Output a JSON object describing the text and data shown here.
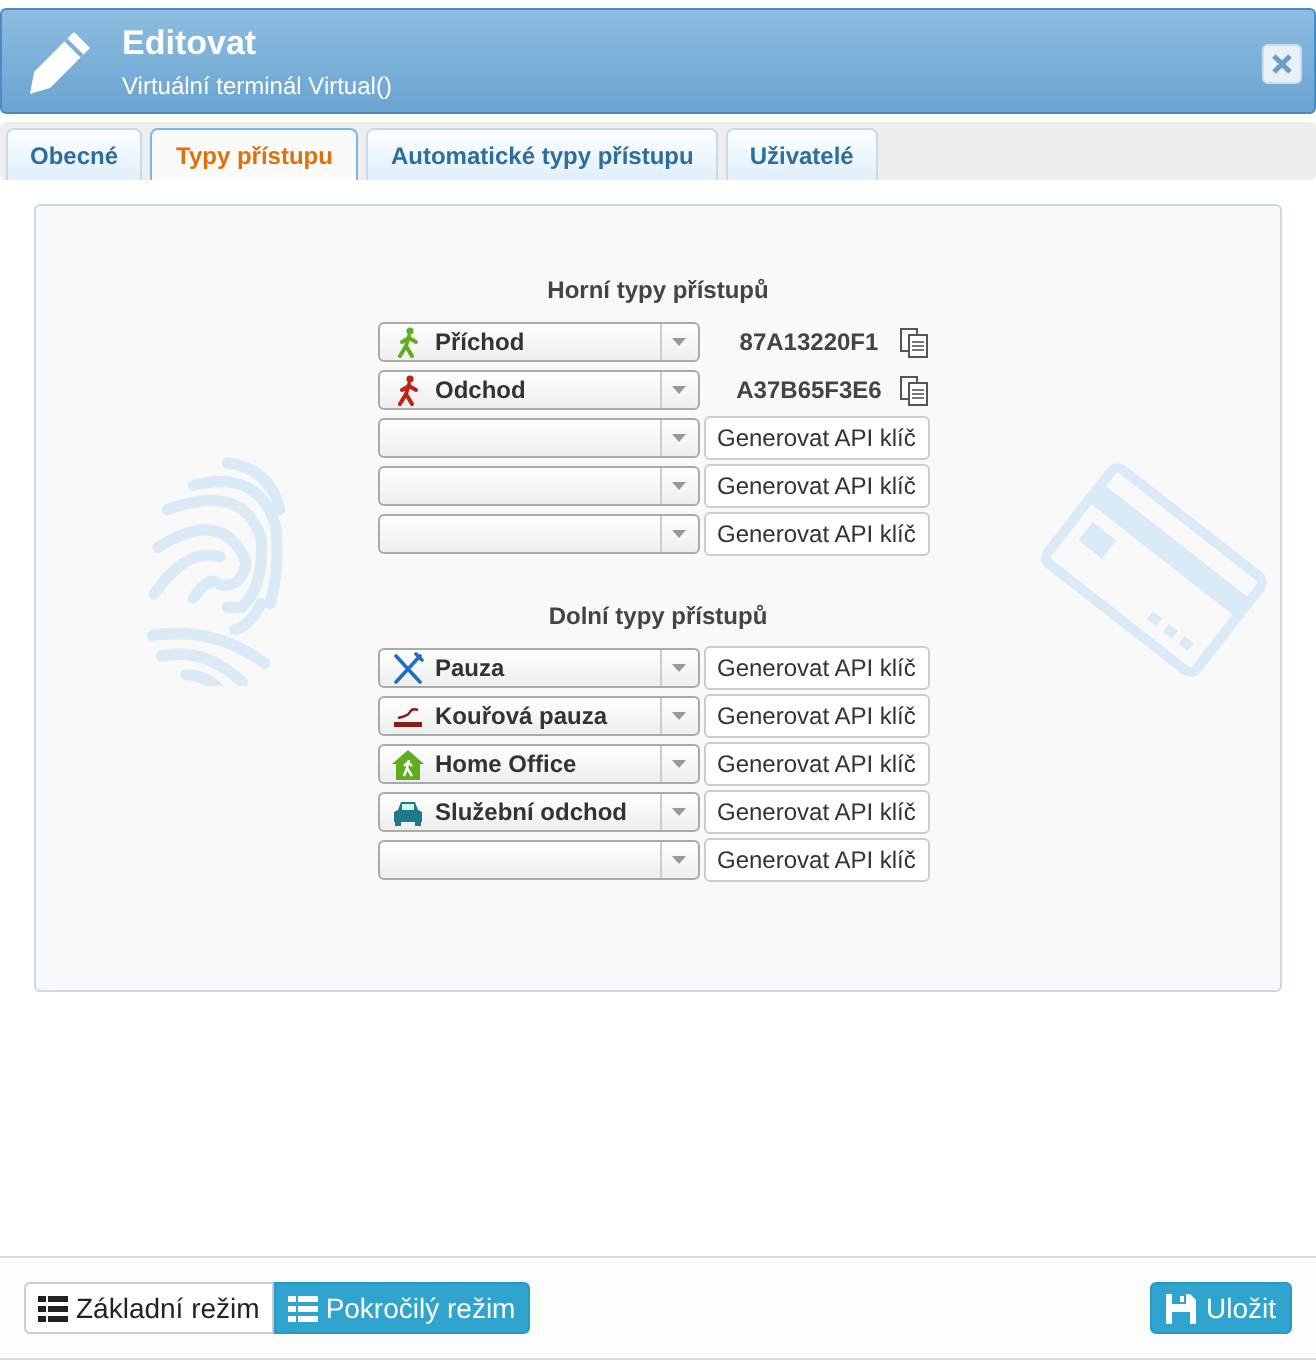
{
  "dialog": {
    "title": "Editovat",
    "subtitle": "Virtuální terminál Virtual()"
  },
  "tabs": [
    {
      "label": "Obecné",
      "selected": false
    },
    {
      "label": "Typy přístupu",
      "selected": true
    },
    {
      "label": "Automatické typy přístupu",
      "selected": false
    },
    {
      "label": "Uživatelé",
      "selected": false
    }
  ],
  "sections": [
    {
      "heading": "Horní typy přístupů",
      "rows": [
        {
          "value": "Příchod",
          "kind": "key",
          "key": "87A13220F1"
        },
        {
          "value": "Odchod",
          "kind": "key",
          "key": "A37B65F3E6"
        },
        {
          "kind": "button",
          "button": "Generovat API klíč"
        },
        {
          "kind": "button",
          "button": "Generovat API klíč"
        },
        {
          "kind": "button",
          "button": "Generovat API klíč"
        }
      ]
    },
    {
      "heading": "Dolní typy přístupů",
      "rows": [
        {
          "value": "Pauza",
          "kind": "button",
          "button": "Generovat API klíč"
        },
        {
          "value": "Kouřová pauza",
          "kind": "button",
          "button": "Generovat API klíč"
        },
        {
          "value": "Home Office",
          "kind": "button",
          "button": "Generovat API klíč"
        },
        {
          "value": "Služební odchod",
          "kind": "button",
          "button": "Generovat API klíč"
        },
        {
          "kind": "button",
          "button": "Generovat API klíč"
        }
      ]
    }
  ],
  "modes": [
    {
      "label": "Základní režim",
      "selected": false
    },
    {
      "label": "Pokročilý režim",
      "selected": true
    }
  ],
  "save_button": "Uložit"
}
